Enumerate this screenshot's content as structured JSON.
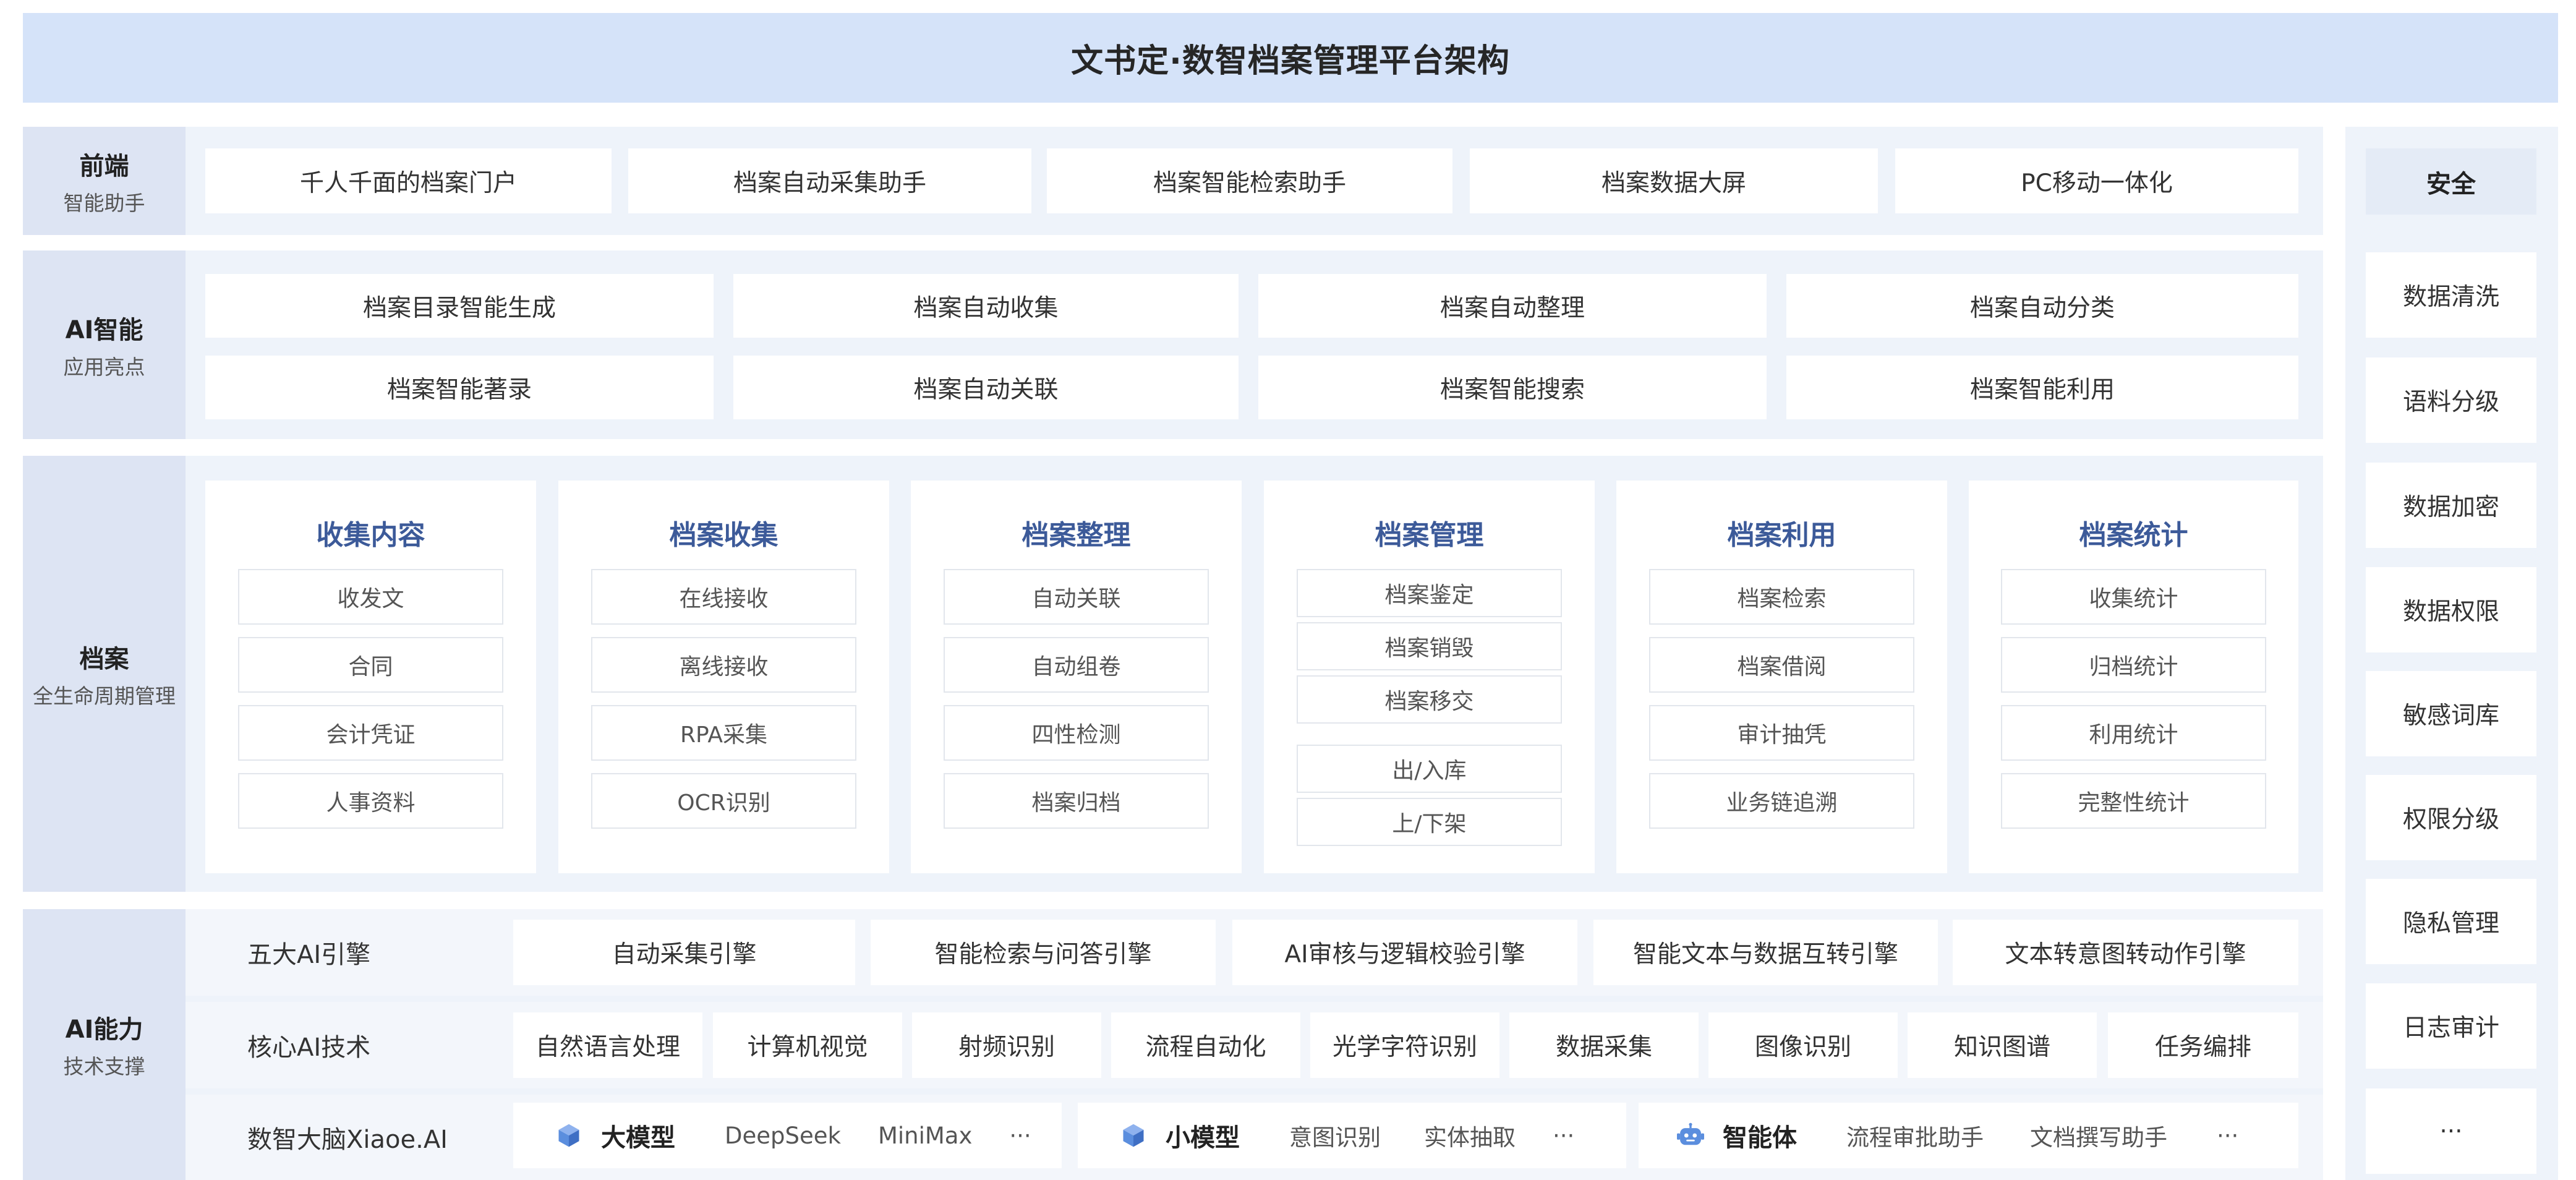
{
  "title": "文书定·数智档案管理平台架构",
  "frontend": {
    "label": "前端",
    "sub": "智能助手",
    "items": [
      "千人千面的档案门户",
      "档案自动采集助手",
      "档案智能检索助手",
      "档案数据大屏",
      "PC移动一体化"
    ]
  },
  "ai_smart": {
    "label": "AI智能",
    "sub": "应用亮点",
    "row1": [
      "档案目录智能生成",
      "档案自动收集",
      "档案自动整理",
      "档案自动分类"
    ],
    "row2": [
      "档案智能著录",
      "档案自动关联",
      "档案智能搜索",
      "档案智能利用"
    ]
  },
  "archive": {
    "label": "档案",
    "sub": "全生命周期管理",
    "cards": [
      {
        "title": "收集内容",
        "items": [
          "收发文",
          "合同",
          "会计凭证",
          "人事资料"
        ]
      },
      {
        "title": "档案收集",
        "items": [
          "在线接收",
          "离线接收",
          "RPA采集",
          "OCR识别"
        ]
      },
      {
        "title": "档案整理",
        "items": [
          "自动关联",
          "自动组卷",
          "四性检测",
          "档案归档"
        ]
      },
      {
        "title": "档案管理",
        "items": [
          "档案鉴定",
          "档案销毁",
          "档案移交",
          "出/入库",
          "上/下架"
        ]
      },
      {
        "title": "档案利用",
        "items": [
          "档案检索",
          "档案借阅",
          "审计抽凭",
          "业务链追溯"
        ]
      },
      {
        "title": "档案统计",
        "items": [
          "收集统计",
          "归档统计",
          "利用统计",
          "完整性统计"
        ]
      }
    ]
  },
  "ai_capability": {
    "label": "AI能力",
    "sub": "技术支撑",
    "engines_label": "五大AI引擎",
    "engines": [
      "自动采集引擎",
      "智能检索与问答引擎",
      "AI审核与逻辑校验引擎",
      "智能文本与数据互转引擎",
      "文本转意图转动作引擎"
    ],
    "tech_label": "核心AI技术",
    "tech": [
      "自然语言处理",
      "计算机视觉",
      "射频识别",
      "流程自动化",
      "光学字符识别",
      "数据采集",
      "图像识别",
      "知识图谱",
      "任务编排"
    ],
    "brain_label": "数智大脑Xiaoe.AI",
    "models": [
      {
        "name": "大模型",
        "icon": "cube-icon",
        "items": [
          "DeepSeek",
          "MiniMax",
          "···"
        ]
      },
      {
        "name": "小模型",
        "icon": "cube-icon",
        "items": [
          "意图识别",
          "实体抽取",
          "···"
        ]
      },
      {
        "name": "智能体",
        "icon": "robot-icon",
        "items": [
          "流程审批助手",
          "文档撰写助手",
          "···"
        ]
      }
    ]
  },
  "security": {
    "label": "安全",
    "items": [
      "数据清洗",
      "语料分级",
      "数据加密",
      "数据权限",
      "敏感词库",
      "权限分级",
      "隐私管理",
      "日志审计",
      "···"
    ]
  },
  "colors": {
    "title_bg": "#d5e3f9",
    "row_bg": "#eef3fa",
    "label_bg": "#dde4f3",
    "card_title": "#3c5a99",
    "icon": "#5b8ede"
  }
}
